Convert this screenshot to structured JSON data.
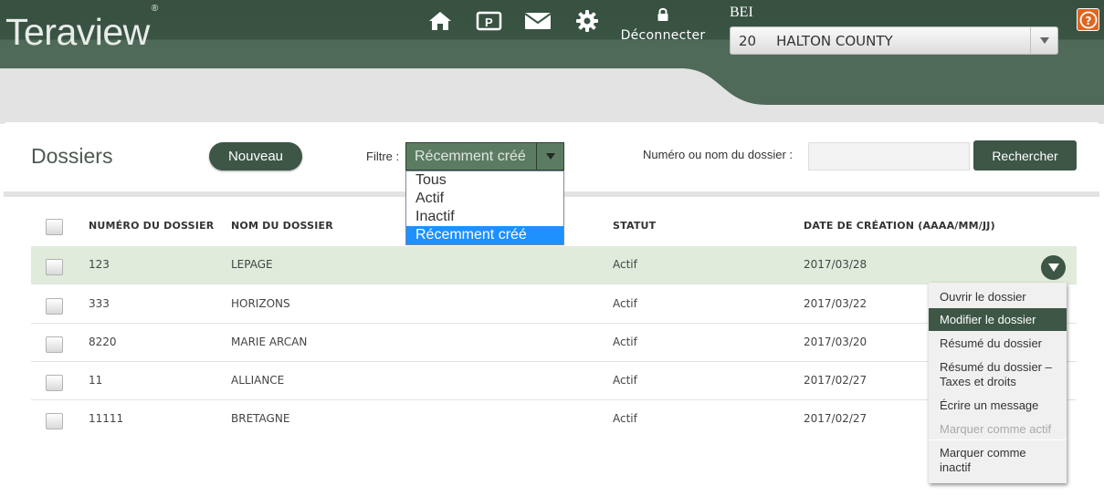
{
  "header": {
    "logo": "Teraview",
    "logo_mark": "®",
    "icons": [
      "home-icon",
      "parking-icon",
      "mail-icon",
      "gear-icon"
    ],
    "logout_label": "Déconnecter",
    "bei_label": "BEI",
    "county": {
      "code": "20",
      "name": "HALTON COUNTY"
    },
    "help_glyph": "?"
  },
  "toolbar": {
    "title": "Dossiers",
    "new_label": "Nouveau",
    "filter_label": "Filtre :",
    "filter_value": "Récemment créé",
    "search_label": "Numéro ou nom du dossier :",
    "search_value": "",
    "search_button": "Rechercher"
  },
  "filter_options": [
    "Tous",
    "Actif",
    "Inactif",
    "Récemment créé"
  ],
  "table": {
    "headers": [
      "NUMÉRO DU DOSSIER",
      "NOM DU DOSSIER",
      "STATUT",
      "DATE DE CRÉATION (AAAA/MM/JJ)"
    ],
    "rows": [
      {
        "number": "123",
        "name": "LEPAGE",
        "status": "Actif",
        "date": "2017/03/28"
      },
      {
        "number": "333",
        "name": "HORIZONS",
        "status": "Actif",
        "date": "2017/03/22"
      },
      {
        "number": "8220",
        "name": "MARIE ARCAN",
        "status": "Actif",
        "date": "2017/03/20"
      },
      {
        "number": "11",
        "name": "ALLIANCE",
        "status": "Actif",
        "date": "2017/02/27"
      },
      {
        "number": "11111",
        "name": "BRETAGNE",
        "status": "Actif",
        "date": "2017/02/27"
      }
    ]
  },
  "context_menu": [
    {
      "label": "Ouvrir le dossier"
    },
    {
      "label": "Modifier le dossier"
    },
    {
      "label": "Résumé du dossier"
    },
    {
      "label": "Résumé du dossier – Taxes et droits"
    },
    {
      "label": "Écrire un message"
    },
    {
      "label": "Marquer comme actif"
    },
    {
      "label": "Marquer comme inactif"
    }
  ],
  "colors": {
    "brand_dark_green": "#37503f",
    "button_green": "#3d5646",
    "selected_row": "#e0ebdc",
    "help_orange": "#e0651e",
    "dropdown_highlight": "#1e90ff"
  }
}
